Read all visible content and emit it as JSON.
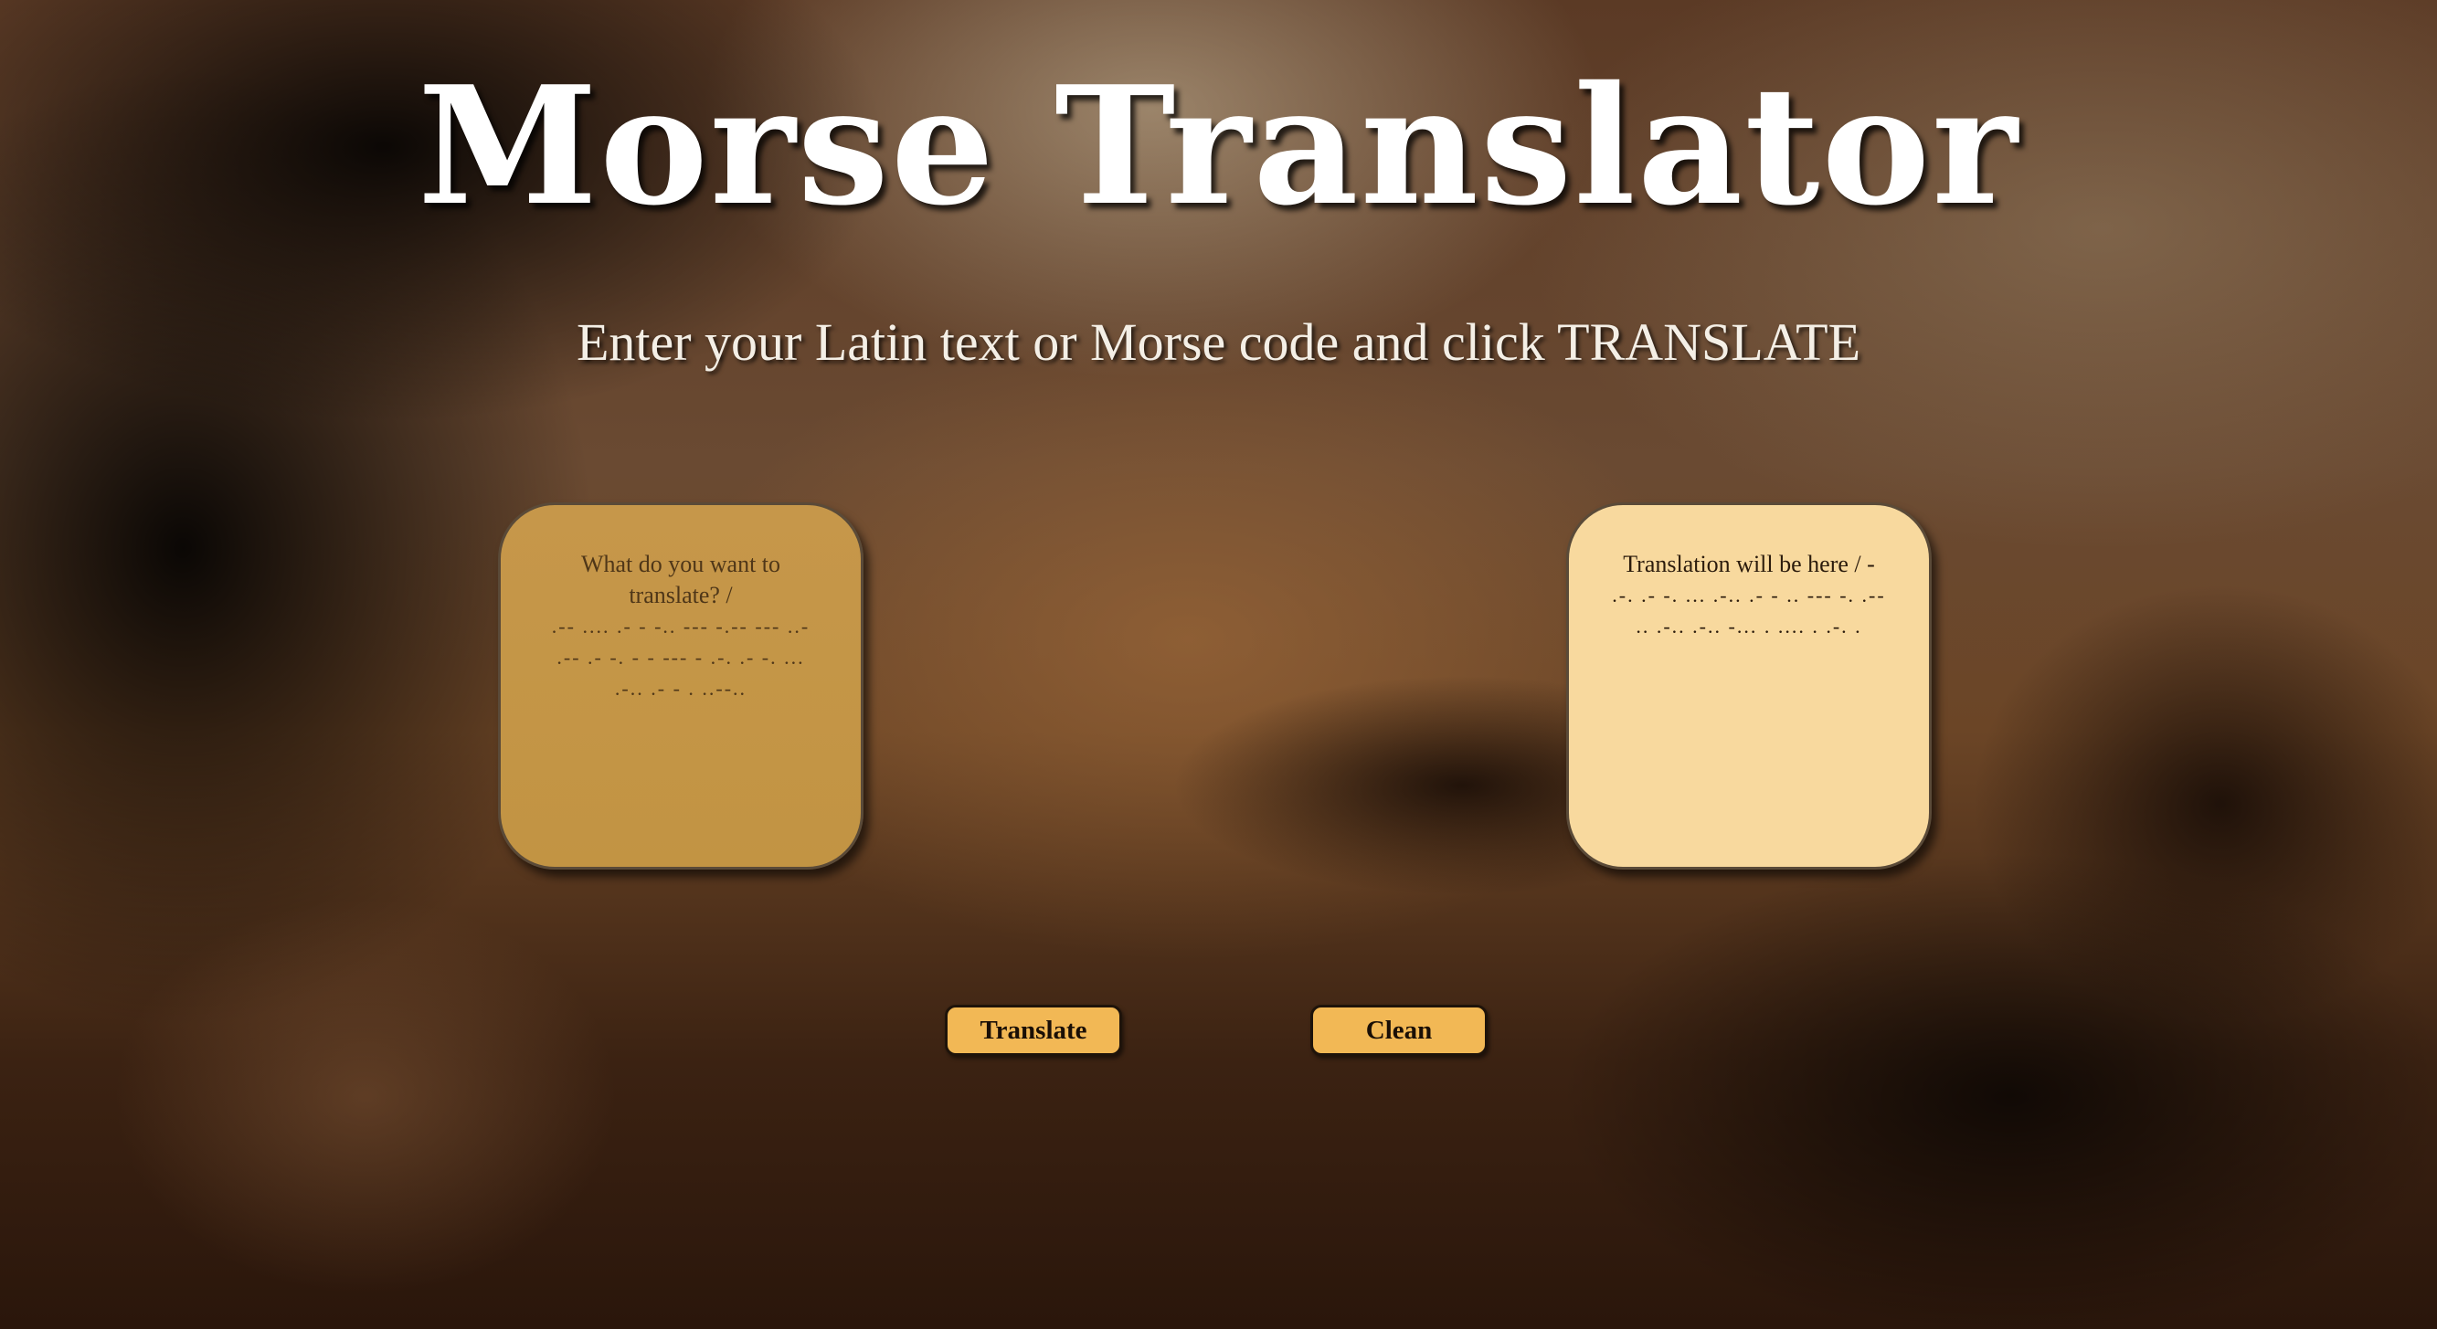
{
  "header": {
    "title": "Morse Translator",
    "subtitle": "Enter your Latin text or Morse code and click TRANSLATE"
  },
  "input_box": {
    "placeholder_text": "What do you want to translate? /",
    "placeholder_morse": ".-- .... .- - -.. --- -.-- --- ..- .-- .- -. - - --- - .-. .- -. ... .-.. .- - . ..--..",
    "value": ""
  },
  "output_box": {
    "placeholder_text": "Translation will be here / -",
    "placeholder_morse": ".-. .- -. ... .-.. .- - .. --- -. .-- .. .-.. .-.. -... . .... . .-. .",
    "value": ""
  },
  "buttons": {
    "translate_label": "Translate",
    "clean_label": "Clean"
  },
  "colors": {
    "input_bg": "#c6974a",
    "output_bg": "#f8d99e",
    "button_bg": "#f2b855",
    "title_text": "#ffffff"
  }
}
